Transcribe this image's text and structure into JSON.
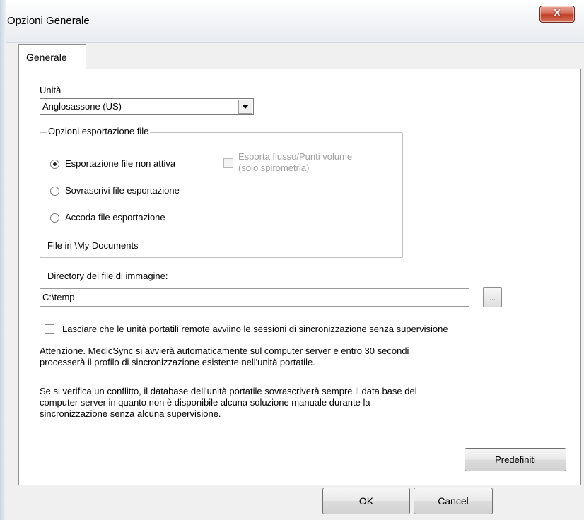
{
  "window": {
    "title": "Opzioni Generale",
    "close_label": "X"
  },
  "tabs": [
    {
      "label": "Generale"
    }
  ],
  "units": {
    "label": "Unità",
    "selected": "Anglosassone (US)"
  },
  "export_group": {
    "title": "Opzioni esportazione file",
    "options": [
      {
        "label": "Esportazione file non attiva",
        "selected": true
      },
      {
        "label": "Sovrascrivi file esportazione",
        "selected": false
      },
      {
        "label": "Accoda file esportazione",
        "selected": false
      }
    ],
    "flow_volume_checkbox": {
      "line1": "Esporta flusso/Punti volume",
      "line2": "(solo spirometria)",
      "checked": false,
      "enabled": false
    },
    "location_note": "File in \\My Documents"
  },
  "image_dir": {
    "label": "Directory del file di immagine:",
    "value": "C:\\temp",
    "browse_label": "..."
  },
  "remote_sync": {
    "label": "Lasciare che le unità portatili remote avviino le sessioni di sincronizzazione senza supervisione",
    "checked": false
  },
  "notes": {
    "warning_line1": "Attenzione.  MedicSync si avvierà automaticamente sul computer server e entro 30 secondi",
    "warning_line2": "processerà il profilo di sincronizzazione esistente nell'unità portatile.",
    "conflict_line1": "Se si verifica un conflitto, il database dell'unità portatile sovrascriverà sempre il data base del",
    "conflict_line2": "computer server in quanto non è disponibile alcuna soluzione manuale durante la",
    "conflict_line3": "sincronizzazione senza alcuna supervisione."
  },
  "buttons": {
    "defaults": "Predefiniti",
    "ok": "OK",
    "cancel": "Cancel"
  }
}
